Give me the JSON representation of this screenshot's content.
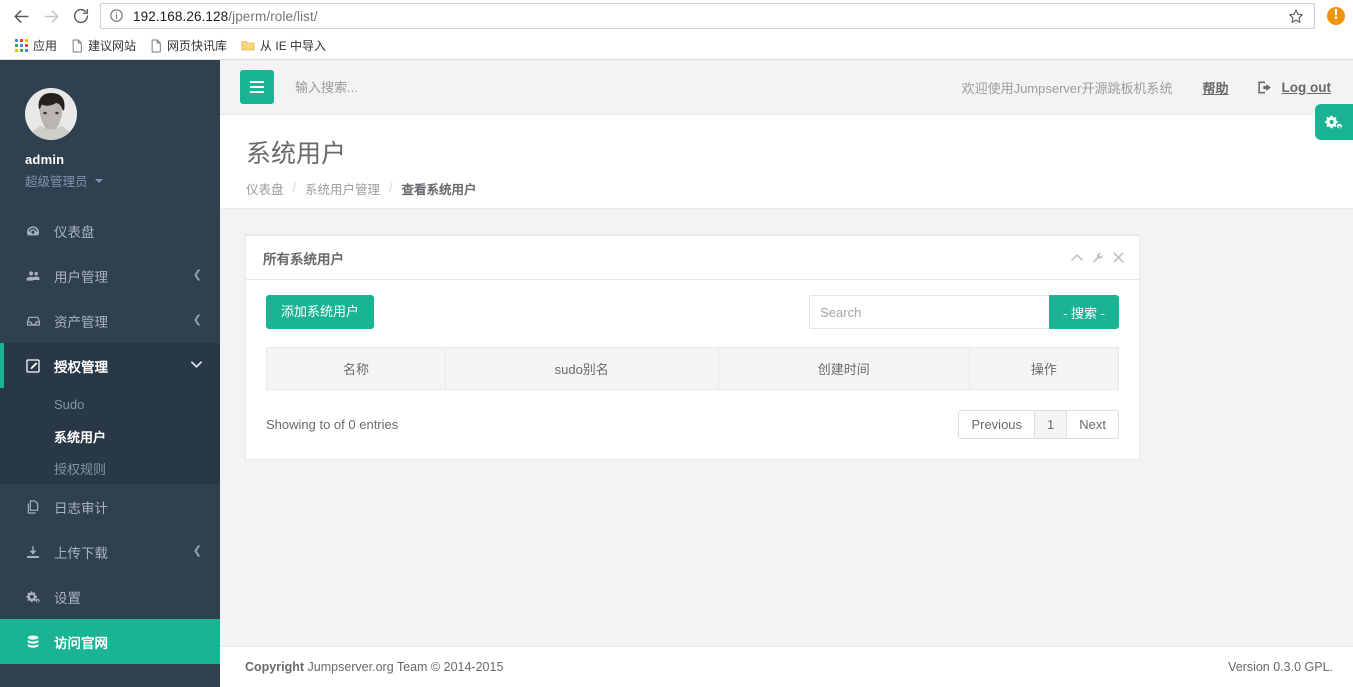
{
  "browser": {
    "back_icon": "back-arrow-icon",
    "forward_icon": "forward-arrow-icon",
    "reload_icon": "reload-icon",
    "info_icon": "page-info-icon",
    "url_host": "192.168.26.128",
    "url_path": "/jperm/role/list/",
    "star_icon": "bookmark-star-icon",
    "warning_badge": "!",
    "bookmarks": [
      {
        "label": "应用",
        "icon": "apps-grid-icon"
      },
      {
        "label": "建议网站",
        "icon": "page-icon"
      },
      {
        "label": "网页快讯库",
        "icon": "page-icon"
      },
      {
        "label": "从 IE 中导入",
        "icon": "folder-icon"
      }
    ]
  },
  "sidebar": {
    "profile": {
      "avatar_icon": "user-avatar",
      "name": "admin",
      "role": "超级管理员",
      "caret_icon": "caret-down-icon"
    },
    "items": [
      {
        "label": "仪表盘",
        "icon": "dashboard-icon",
        "chevron": "",
        "state": ""
      },
      {
        "label": "用户管理",
        "icon": "users-icon",
        "chevron": "❮",
        "state": ""
      },
      {
        "label": "资产管理",
        "icon": "inbox-icon",
        "chevron": "❮",
        "state": ""
      },
      {
        "label": "授权管理",
        "icon": "edit-square-icon",
        "chevron": "❯",
        "state": "active"
      },
      {
        "label": "日志审计",
        "icon": "files-icon",
        "chevron": "",
        "state": ""
      },
      {
        "label": "上传下载",
        "icon": "download-icon",
        "chevron": "❮",
        "state": ""
      },
      {
        "label": "设置",
        "icon": "gears-icon",
        "chevron": "",
        "state": ""
      },
      {
        "label": "访问官网",
        "icon": "database-icon",
        "chevron": "",
        "state": "green"
      }
    ],
    "submenu": [
      {
        "label": "Sudo",
        "state": ""
      },
      {
        "label": "系统用户",
        "state": "active"
      },
      {
        "label": "授权规则",
        "state": ""
      }
    ]
  },
  "topnav": {
    "menu_toggle_icon": "hamburger-icon",
    "search_placeholder": "输入搜索...",
    "search_value": "",
    "welcome": "欢迎使用Jumpserver开源跳板机系统",
    "help": "帮助",
    "logout_icon": "sign-out-icon",
    "logout": "Log out"
  },
  "page": {
    "title": "系统用户",
    "breadcrumb": [
      {
        "label": "仪表盘",
        "current": false
      },
      {
        "label": "系统用户管理",
        "current": false
      },
      {
        "label": "查看系统用户",
        "current": true
      }
    ],
    "separator": "/",
    "settings_tab_icon": "cogs-icon"
  },
  "panel": {
    "title": "所有系统用户",
    "tools": [
      {
        "icon": "chevron-up-icon"
      },
      {
        "icon": "wrench-icon"
      },
      {
        "icon": "close-icon"
      }
    ],
    "add_button": "添加系统用户",
    "search_placeholder": "Search",
    "search_value": "",
    "search_button": "- 搜索 -",
    "table": {
      "columns": [
        "名称",
        "sudo别名",
        "创建时间",
        "操作"
      ],
      "rows": []
    },
    "entries_info": "Showing to of 0 entries",
    "pager": [
      {
        "label": "Previous",
        "current": false
      },
      {
        "label": "1",
        "current": true
      },
      {
        "label": "Next",
        "current": false
      }
    ]
  },
  "footer": {
    "copyright_bold": "Copyright",
    "copyright_rest": " Jumpserver.org Team © 2014-2015",
    "version": "Version 0.3.0 GPL."
  },
  "colors": {
    "brand_green": "#1ab394",
    "sidebar_dark": "#2f4050",
    "sidebar_darker": "#293846",
    "text_muted": "#676a6c",
    "warning_orange": "#f0930b"
  }
}
